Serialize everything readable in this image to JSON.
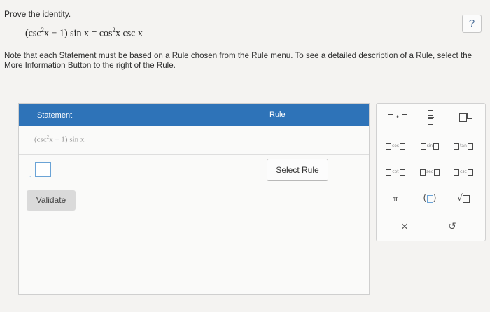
{
  "prompt": "Prove the identity.",
  "help_label": "?",
  "identity": {
    "lhs_open": "(csc",
    "lhs_exp": "2",
    "lhs_mid": "x − 1) sin x = cos",
    "rhs_exp": "2",
    "rhs_end": "x csc x"
  },
  "note": "Note that each Statement must be based on a Rule chosen from the Rule menu. To see a detailed description of a Rule, select the More Information Button to the right of the Rule.",
  "table": {
    "header_statement": "Statement",
    "header_rule": "Rule",
    "row1": {
      "open": "(csc",
      "exp": "2",
      "rest": "x − 1) sin x"
    },
    "bullet": "·",
    "select_rule_label": "Select Rule",
    "validate_label": "Validate"
  },
  "palette": {
    "times_sign": "•",
    "cos": "cos",
    "sin": "sin",
    "tan": "tan",
    "cot": "cot",
    "sec": "sec",
    "csc": "csc",
    "pi": "π",
    "open_paren": "(",
    "close_paren": ")",
    "sqrt_sign": "√",
    "clear": "×",
    "undo": "↺"
  },
  "colors": {
    "header_blue": "#2e73b8",
    "accent": "#6aa3d6"
  }
}
